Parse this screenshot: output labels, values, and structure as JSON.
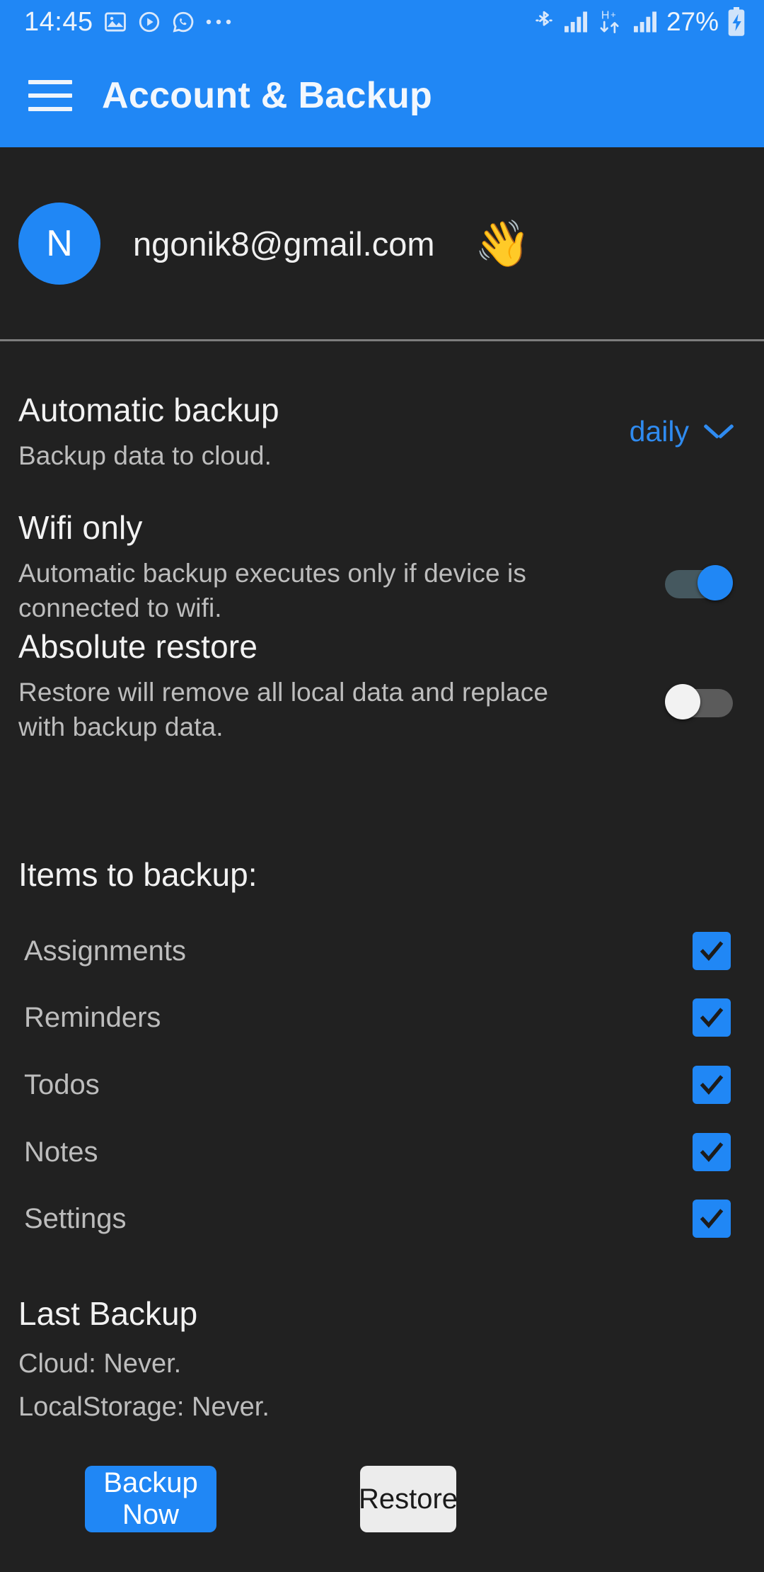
{
  "status_bar": {
    "time": "14:45",
    "left_icons": [
      "photos-icon",
      "play-circle-icon",
      "whatsapp-icon",
      "more-dots-icon"
    ],
    "right_icons": [
      "bluetooth-icon",
      "signal-bars-icon",
      "hspa-data-icon",
      "signal-bars-2-icon"
    ],
    "battery_percent": "27%",
    "battery_icon": "battery-charging-icon"
  },
  "app_bar": {
    "menu_icon": "hamburger-menu-icon",
    "title": "Account & Backup"
  },
  "account": {
    "avatar_initial": "N",
    "email": "ngonik8@gmail.com",
    "wave_emoji": "👋"
  },
  "settings": {
    "automatic_backup": {
      "title": "Automatic backup",
      "subtitle": "Backup data to cloud.",
      "frequency_value": "daily",
      "frequency_options": [
        "daily"
      ]
    },
    "wifi_only": {
      "title": "Wifi only",
      "subtitle": "Automatic backup executes only if device is connected to wifi.",
      "enabled": true
    },
    "absolute_restore": {
      "title": "Absolute restore",
      "subtitle": "Restore will remove all local data and replace with backup data.",
      "enabled": false
    }
  },
  "items_to_backup": {
    "heading": "Items to backup:",
    "items": [
      {
        "label": "Assignments",
        "checked": true
      },
      {
        "label": "Reminders",
        "checked": true
      },
      {
        "label": "Todos",
        "checked": true
      },
      {
        "label": "Notes",
        "checked": true
      },
      {
        "label": "Settings",
        "checked": true
      }
    ]
  },
  "last_backup": {
    "heading": "Last Backup",
    "cloud": "Cloud: Never.",
    "local": "LocalStorage: Never."
  },
  "actions": {
    "backup_now": "Backup Now",
    "restore": "Restore"
  },
  "colors": {
    "accent": "#2087f5",
    "background": "#212121",
    "divider": "#7d7d7d",
    "text_primary": "#f2f2f2",
    "text_secondary": "#bdbdbd"
  }
}
